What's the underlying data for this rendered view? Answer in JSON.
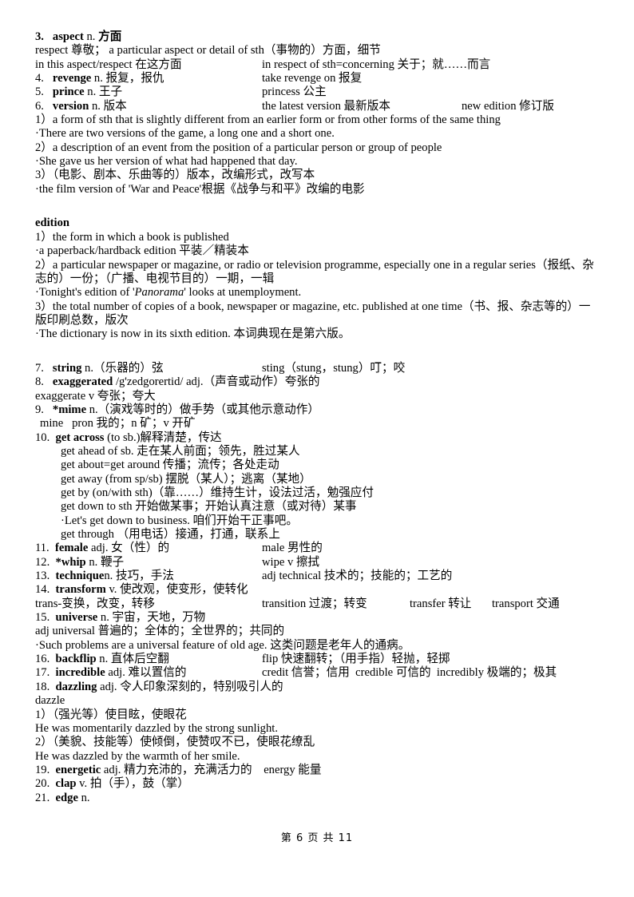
{
  "document": {
    "footer": "第 6 页 共 11",
    "entries": [
      {
        "num": "3.",
        "headword": "aspect",
        "pos": "n.",
        "gloss": "方面",
        "lines": [
          "respect 尊敬； a particular aspect or detail of sth（事物的）方面，细节",
          {
            "col1": "in this aspect/respect 在这方面",
            "col2": "in respect of sth=concerning 关于；就……而言"
          }
        ]
      },
      {
        "num": "4.",
        "headword": "revenge",
        "pos": "n.",
        "gloss": "报复，报仇",
        "col2": "take revenge on 报复"
      },
      {
        "num": "5.",
        "headword": "prince",
        "pos": "n.",
        "gloss": "王子",
        "col2": "princess 公主"
      },
      {
        "num": "6.",
        "headword": "version",
        "pos": "n.",
        "gloss": "版本",
        "col2": "the latest version 最新版本",
        "col3": "new edition 修订版",
        "senses": [
          "1）a form of sth that is slightly different from an earlier form or from other forms of the same thing",
          "·There are two versions of the game, a long one and a short one.",
          "2）a description of an event from the position of a particular person or group of people",
          "·She gave us her version of what had happened that day.",
          "3）（电影、剧本、乐曲等的）版本，改编形式，改写本",
          "·the film version of 'War and Peace'根据《战争与和平》改编的电影"
        ]
      },
      {
        "headword": "edition",
        "senses": [
          "1）the form in which a book is published",
          "·a paperback/hardback edition 平装／精装本",
          "2）a particular newspaper or magazine, or radio or television programme, especially one in a regular series（报纸、杂志的）一份；（广播、电视节目的）一期，一辑",
          "3）the total number of copies of a book, newspaper or magazine, etc. published at one time（书、报、杂志等的）一版印刷总数，版次",
          "·The dictionary is now in its sixth edition. 本词典现在是第六版。"
        ],
        "italic_example_prefix": "·Tonight's edition of '",
        "italic_example_word": "Panorama",
        "italic_example_suffix": "' looks at unemployment."
      },
      {
        "num": "7.",
        "headword": "string",
        "pos": "n.",
        "gloss": "（乐器的）弦",
        "col2": "sting（stung，stung）叮；咬"
      },
      {
        "num": "8.",
        "headword": "exaggerated",
        "phonetic": "/g'zedgorertid/",
        "pos": "adj.",
        "gloss": "（声音或动作）夸张的",
        "sub": "exaggerate v 夸张；夸大"
      },
      {
        "num": "9.",
        "headword": "*mime",
        "pos": "n.",
        "gloss": "（演戏等时的）做手势（或其他示意动作）",
        "sub": "mine   pron 我的；n 矿；v 开矿"
      },
      {
        "num": "10.",
        "headword": "get across",
        "tail": "(to sb.)解释清楚，传达",
        "phrases": [
          "get ahead of sb. 走在某人前面；领先，胜过某人",
          "get about=get around 传播；流传；各处走动",
          "get away (from sp/sb) 摆脱（某人）；逃离（某地）",
          "get by (on/with sth)（靠……）维持生计，设法过活，勉强应付",
          "get down to sth 开始做某事；开始认真注意（或对待）某事",
          "·Let's get down to business. 咱们开始干正事吧。",
          "get through （用电话）接通，打通，联系上"
        ]
      },
      {
        "num": "11.",
        "headword": "female",
        "pos": "adj.",
        "gloss": "女（性）的",
        "col2": "male 男性的"
      },
      {
        "num": "12.",
        "headword": "*whip",
        "pos": "n.",
        "gloss": "鞭子",
        "col2": "wipe v 擦拭"
      },
      {
        "num": "13.",
        "headword": "technique",
        "pos": "n.",
        "gloss": "技巧，手法",
        "col2": "adj technical 技术的；技能的；工艺的"
      },
      {
        "num": "14.",
        "headword": "transform",
        "pos": "v.",
        "gloss": "使改观，使变形，使转化",
        "sub_cols": [
          "trans-变换，改变，转移",
          "transition 过渡；转变",
          "transfer 转让",
          "transport 交通"
        ]
      },
      {
        "num": "15.",
        "headword": "universe",
        "pos": "n.",
        "gloss": "宇宙，天地，万物",
        "sub": "adj universal 普遍的；全体的；全世界的；共同的",
        "example": "·Such problems are a universal feature of old age. 这类问题是老年人的通病。"
      },
      {
        "num": "16.",
        "headword": "backflip",
        "pos": "n.",
        "gloss": "直体后空翻",
        "col2": "flip 快速翻转；（用手指）轻抛，轻掷"
      },
      {
        "num": "17.",
        "headword": "incredible",
        "pos": "adj.",
        "gloss": "难以置信的",
        "col2": "credit 信誉；信用  credible 可信的  incredibly 极端的；极其"
      },
      {
        "num": "18.",
        "headword": "dazzling",
        "pos": "adj.",
        "gloss": "令人印象深刻的，特别吸引人的",
        "sub": "dazzle",
        "senses": [
          "1）（强光等）使目眩，使眼花",
          "He was momentarily dazzled by the strong sunlight.",
          "2）（美貌、技能等）使倾倒，使赞叹不已，使眼花缭乱",
          "He was dazzled by the warmth of her smile."
        ]
      },
      {
        "num": "19.",
        "headword": "energetic",
        "pos": "adj.",
        "gloss": "精力充沛的，充满活力的",
        "col2": "energy 能量"
      },
      {
        "num": "20.",
        "headword": "clap",
        "pos": "v.",
        "gloss": "拍（手），鼓（掌）"
      },
      {
        "num": "21.",
        "headword": "edge",
        "pos": "n."
      }
    ]
  }
}
